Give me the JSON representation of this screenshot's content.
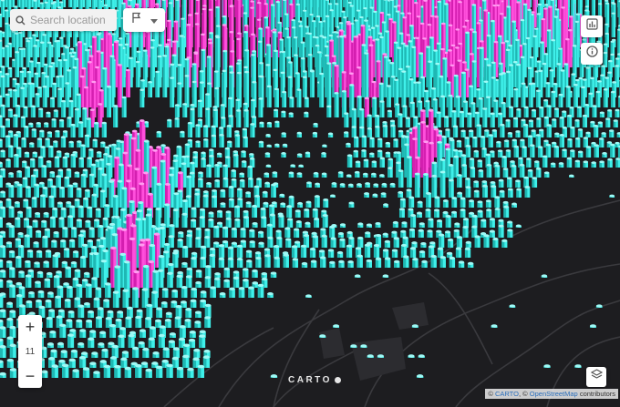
{
  "search": {
    "placeholder": "Search location"
  },
  "filter": {
    "icon": "flag-icon",
    "dropdown_icon": "caret-down-icon"
  },
  "toolbar": {
    "chart_icon": "bar-chart-icon",
    "info_icon": "info-icon",
    "layers_icon": "layers-icon"
  },
  "zoom": {
    "in_label": "+",
    "level": "11",
    "out_label": "−"
  },
  "logo": {
    "text": "CARTO"
  },
  "attribution": {
    "copyright": "©",
    "carto": "CARTO",
    "sep": ", ©",
    "osm": "OpenStreetMap",
    "suffix": "contributors"
  },
  "colors": {
    "low": "#39e6e0",
    "high": "#ff2ecf",
    "base": "#1d1d20",
    "roads": "#3a3a3e"
  }
}
